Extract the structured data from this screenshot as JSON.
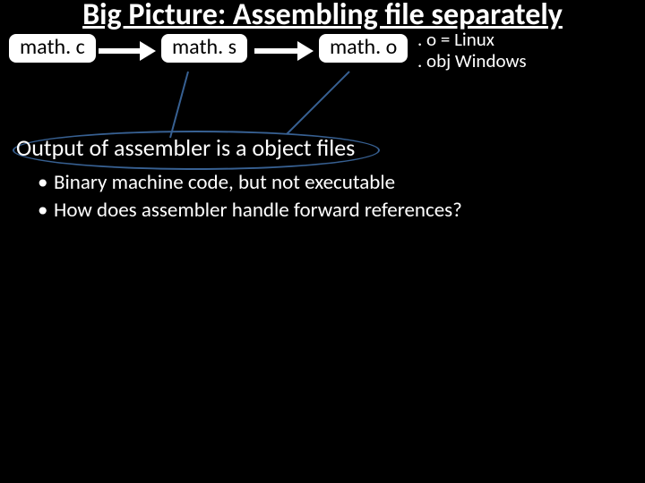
{
  "title": "Big Picture: Assembling file separately",
  "files": {
    "c": "math. c",
    "s": "math. s",
    "o": "math. o"
  },
  "legend": {
    "line1": ". o = Linux",
    "line2": ". obj Windows"
  },
  "body": {
    "heading": "Output of assembler is a object files",
    "bullets": [
      "Binary machine code, but not executable",
      "How does assembler handle forward references?"
    ]
  }
}
